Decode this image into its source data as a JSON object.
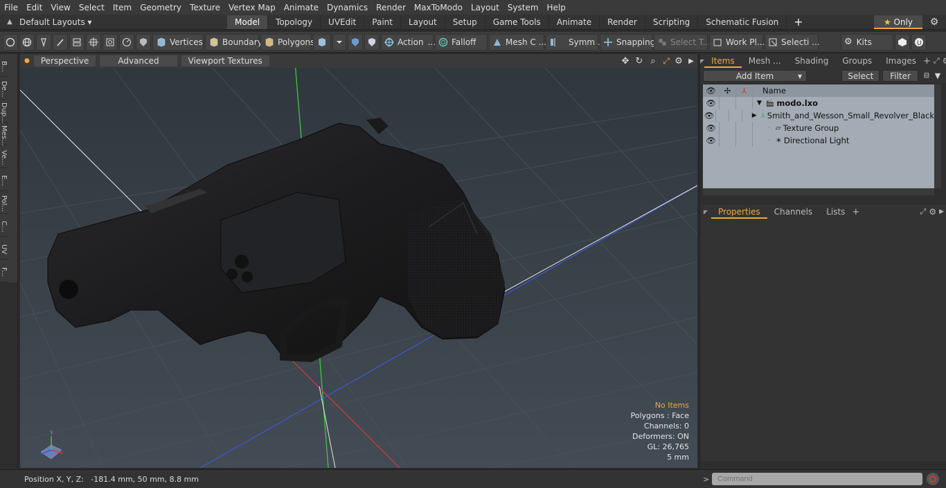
{
  "menu": [
    "File",
    "Edit",
    "View",
    "Select",
    "Item",
    "Geometry",
    "Texture",
    "Vertex Map",
    "Animate",
    "Dynamics",
    "Render",
    "MaxToModo",
    "Layout",
    "System",
    "Help"
  ],
  "layouts": {
    "selector": "Default Layouts",
    "tabs": [
      "Model",
      "Topology",
      "UVEdit",
      "Paint",
      "Layout",
      "Setup",
      "Game Tools",
      "Animate",
      "Render",
      "Scripting",
      "Schematic Fusion"
    ],
    "active": "Model",
    "only_label": "Only"
  },
  "toolbar": {
    "vertices": "Vertices",
    "boundary": "Boundary",
    "polygons": "Polygons",
    "action": "Action",
    "falloff": "Falloff",
    "mesh": "Mesh C ...",
    "symm": "Symm ...",
    "snapping": "Snapping",
    "select_t": "Select T...",
    "workpl": "Work Pl...",
    "selecti": "Selecti ...",
    "kits": "Kits"
  },
  "left_tabs": [
    "B...",
    "De...",
    "Dup...",
    "Mes...",
    "Ve...",
    "E...",
    "Pol...",
    "C...",
    "UV",
    "F..."
  ],
  "viewport": {
    "perspective": "Perspective",
    "advanced": "Advanced",
    "textures": "Viewport Textures",
    "info": {
      "no_items": "No Items",
      "polygons": "Polygons : Face",
      "channels": "Channels: 0",
      "deformers": "Deformers: ON",
      "gl": "GL: 26,765",
      "scale": "5 mm"
    }
  },
  "status": "Position X, Y, Z:   -181.4 mm, 50 mm, 8.8 mm",
  "items_panel": {
    "tabs": [
      "Items",
      "Mesh ...",
      "Shading",
      "Groups",
      "Images"
    ],
    "active": "Items",
    "add_item": "Add Item",
    "select": "Select",
    "filter": "Filter",
    "name_header": "Name",
    "rows": [
      {
        "label": "modo.lxo"
      },
      {
        "label": "Smith_and_Wesson_Small_Revolver_Black"
      },
      {
        "label": "Texture Group"
      },
      {
        "label": "Directional Light"
      }
    ]
  },
  "props_panel": {
    "tabs": [
      "Properties",
      "Channels",
      "Lists"
    ],
    "active": "Properties"
  },
  "command_placeholder": "Command",
  "colors": {
    "accent": "#f2a93b",
    "viewport_bg": "#383f47",
    "axis_x": "#d43c3c",
    "axis_y": "#3ccb3c",
    "axis_z": "#3c5ad4"
  }
}
